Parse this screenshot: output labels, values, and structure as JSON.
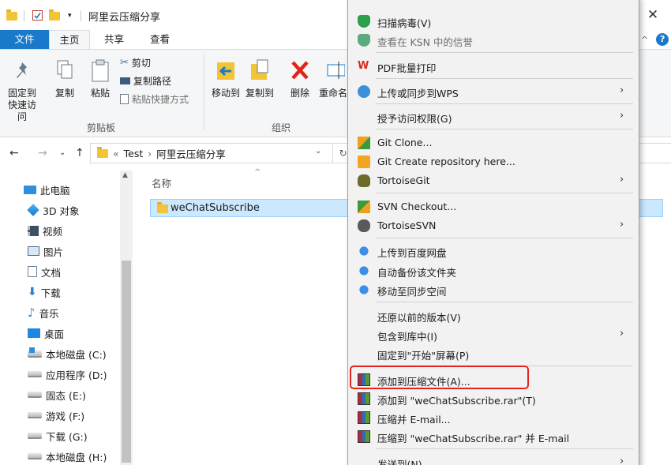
{
  "window": {
    "title": "阿里云压缩分享",
    "close_glyph": "✕"
  },
  "ribbon_tabs": [
    "文件",
    "主页",
    "共享",
    "查看"
  ],
  "ribbon": {
    "pin_label_1": "固定到",
    "pin_label_2": "快速访问",
    "copy_label": "复制",
    "paste_label": "粘贴",
    "cut_label": "剪切",
    "copy_path_label": "复制路径",
    "paste_shortcut_label": "粘贴快捷方式",
    "clipboard_group": "剪贴板",
    "move_to_label": "移动到",
    "copy_to_label": "复制到",
    "delete_label": "删除",
    "rename_label": "重命名",
    "organize_group": "组织"
  },
  "address": {
    "overflow": "«",
    "crumb_1": "Test",
    "sep": "›",
    "crumb_2": "阿里云压缩分享"
  },
  "nav_pane": {
    "items": [
      {
        "label": "此电脑",
        "icon": "pc-icon"
      },
      {
        "label": "3D 对象",
        "icon": "3d-objects-icon"
      },
      {
        "label": "视频",
        "icon": "video-icon"
      },
      {
        "label": "图片",
        "icon": "pictures-icon"
      },
      {
        "label": "文档",
        "icon": "documents-icon"
      },
      {
        "label": "下载",
        "icon": "downloads-icon"
      },
      {
        "label": "音乐",
        "icon": "music-icon"
      },
      {
        "label": "桌面",
        "icon": "desktop-icon"
      },
      {
        "label": "本地磁盘 (C:)",
        "icon": "drive-c-icon"
      },
      {
        "label": "应用程序 (D:)",
        "icon": "drive-icon"
      },
      {
        "label": "固态 (E:)",
        "icon": "drive-icon"
      },
      {
        "label": "游戏 (F:)",
        "icon": "drive-icon"
      },
      {
        "label": "下载 (G:)",
        "icon": "drive-icon"
      },
      {
        "label": "本地磁盘 (H:)",
        "icon": "drive-icon"
      }
    ]
  },
  "file_list": {
    "column_name": "名称",
    "files": [
      {
        "name": "weChatSubscribe",
        "type": "folder",
        "selected": true
      }
    ]
  },
  "context_menu": {
    "items": [
      {
        "label": "扫描病毒(V)",
        "icon": "shield-icon"
      },
      {
        "label": "查看在 KSN 中的信誉",
        "icon": "shield-gray-icon",
        "disabled": true
      },
      {
        "label": "PDF批量打印",
        "icon": "wps-icon"
      },
      {
        "label": "上传或同步到WPS",
        "icon": "wps-cloud-icon",
        "submenu": true
      },
      {
        "label": "授予访问权限(G)",
        "submenu": true
      },
      {
        "label": "Git Clone...",
        "icon": "git-clone-icon"
      },
      {
        "label": "Git Create repository here...",
        "icon": "git-create-icon"
      },
      {
        "label": "TortoiseGit",
        "icon": "tortoisegit-icon",
        "submenu": true
      },
      {
        "label": "SVN Checkout...",
        "icon": "svn-checkout-icon"
      },
      {
        "label": "TortoiseSVN",
        "icon": "tortoisesvn-icon",
        "submenu": true
      },
      {
        "label": "上传到百度网盘",
        "icon": "baidu-icon"
      },
      {
        "label": "自动备份该文件夹",
        "icon": "baidu-icon"
      },
      {
        "label": "移动至同步空间",
        "icon": "baidu-icon"
      },
      {
        "label": "还原以前的版本(V)"
      },
      {
        "label": "包含到库中(I)",
        "submenu": true
      },
      {
        "label": "固定到\"开始\"屏幕(P)"
      },
      {
        "label": "添加到压缩文件(A)...",
        "icon": "winrar-icon",
        "highlighted": true
      },
      {
        "label": "添加到 \"weChatSubscribe.rar\"(T)",
        "icon": "winrar-icon"
      },
      {
        "label": "压缩并 E-mail...",
        "icon": "winrar-icon"
      },
      {
        "label": "压缩到 \"weChatSubscribe.rar\" 并 E-mail",
        "icon": "winrar-icon"
      },
      {
        "label": "发送到(N)",
        "submenu": true
      }
    ]
  },
  "colors": {
    "accent": "#1979ca",
    "selection_bg": "#cce8ff",
    "highlight_border": "#e8231c",
    "menu_bg": "#f2f2f2"
  }
}
